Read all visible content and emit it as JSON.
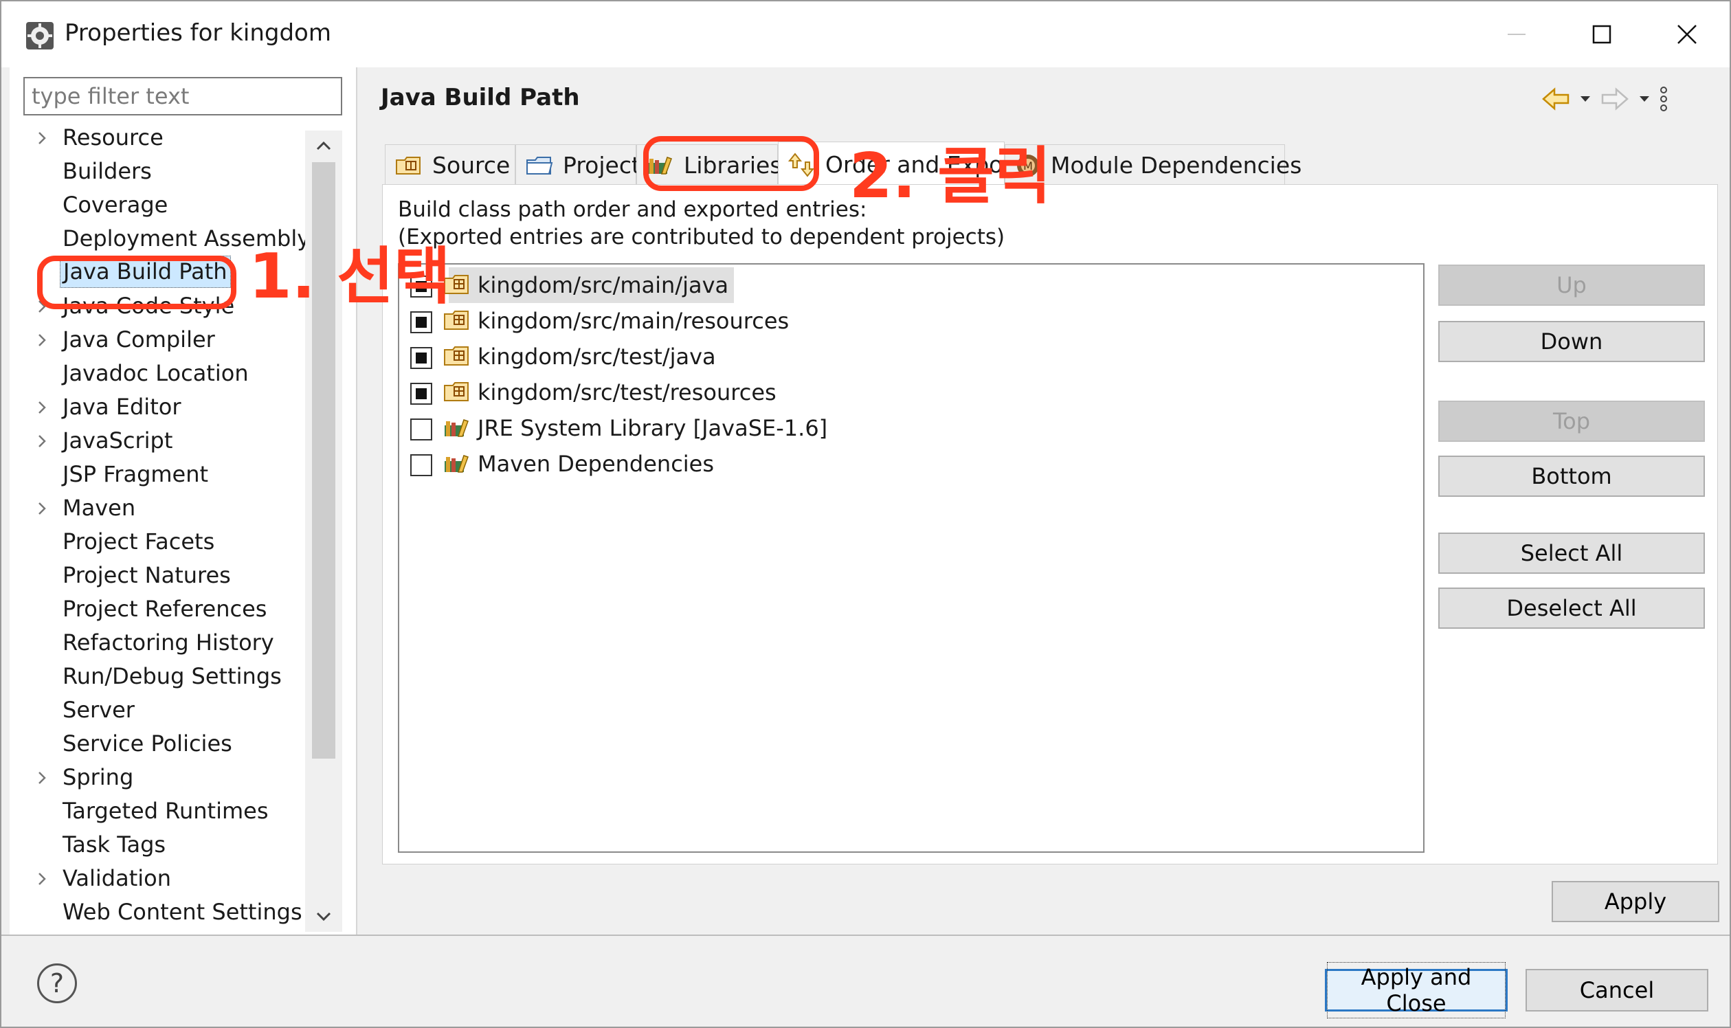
{
  "window": {
    "title": "Properties for kingdom",
    "icons": {
      "app": "gear-icon",
      "minimize": "minimize-icon",
      "maximize": "maximize-icon",
      "close": "close-icon"
    }
  },
  "filter": {
    "placeholder": "type filter text",
    "value": ""
  },
  "tree": {
    "items": [
      {
        "label": "Resource",
        "expandable": true
      },
      {
        "label": "Builders",
        "expandable": false
      },
      {
        "label": "Coverage",
        "expandable": false
      },
      {
        "label": "Deployment Assembly",
        "expandable": false
      },
      {
        "label": "Java Build Path",
        "expandable": false,
        "selected": true
      },
      {
        "label": "Java Code Style",
        "expandable": true
      },
      {
        "label": "Java Compiler",
        "expandable": true
      },
      {
        "label": "Javadoc Location",
        "expandable": false
      },
      {
        "label": "Java Editor",
        "expandable": true
      },
      {
        "label": "JavaScript",
        "expandable": true
      },
      {
        "label": "JSP Fragment",
        "expandable": false
      },
      {
        "label": "Maven",
        "expandable": true
      },
      {
        "label": "Project Facets",
        "expandable": false
      },
      {
        "label": "Project Natures",
        "expandable": false
      },
      {
        "label": "Project References",
        "expandable": false
      },
      {
        "label": "Refactoring History",
        "expandable": false
      },
      {
        "label": "Run/Debug Settings",
        "expandable": false
      },
      {
        "label": "Server",
        "expandable": false
      },
      {
        "label": "Service Policies",
        "expandable": false
      },
      {
        "label": "Spring",
        "expandable": true
      },
      {
        "label": "Targeted Runtimes",
        "expandable": false
      },
      {
        "label": "Task Tags",
        "expandable": false
      },
      {
        "label": "Validation",
        "expandable": true
      },
      {
        "label": "Web Content Settings",
        "expandable": false
      }
    ]
  },
  "page": {
    "title": "Java Build Path",
    "nav_icons": [
      "back-arrow-icon",
      "dropdown-icon",
      "forward-arrow-icon",
      "dropdown-icon",
      "view-menu-icon"
    ]
  },
  "tabs": [
    {
      "label": "Source",
      "icon": "source-folder-icon"
    },
    {
      "label": "Projects",
      "icon": "project-icon"
    },
    {
      "label": "Libraries",
      "icon": "library-icon"
    },
    {
      "label": "Order and Export",
      "icon": "order-export-icon",
      "active": true
    },
    {
      "label": "Module Dependencies",
      "icon": "module-icon"
    }
  ],
  "order_export": {
    "description_line1": "Build class path order and exported entries:",
    "description_line2": "(Exported entries are contributed to dependent projects)",
    "entries": [
      {
        "label": "kingdom/src/main/java",
        "checked": true,
        "icon": "source-folder-icon",
        "selected": true
      },
      {
        "label": "kingdom/src/main/resources",
        "checked": true,
        "icon": "source-folder-icon"
      },
      {
        "label": "kingdom/src/test/java",
        "checked": true,
        "icon": "source-folder-icon"
      },
      {
        "label": "kingdom/src/test/resources",
        "checked": true,
        "icon": "source-folder-icon"
      },
      {
        "label": "JRE System Library [JavaSE-1.6]",
        "checked": false,
        "icon": "library-icon"
      },
      {
        "label": "Maven Dependencies",
        "checked": false,
        "icon": "library-icon"
      }
    ],
    "buttons": [
      {
        "label": "Up",
        "enabled": false
      },
      {
        "label": "Down",
        "enabled": true
      },
      {
        "label": "Top",
        "enabled": false
      },
      {
        "label": "Bottom",
        "enabled": true
      },
      {
        "label": "Select All",
        "enabled": true
      },
      {
        "label": "Deselect All",
        "enabled": true
      }
    ]
  },
  "footer": {
    "apply": "Apply",
    "apply_and_close": "Apply and Close",
    "cancel": "Cancel",
    "help_icon": "help-icon"
  },
  "annotations": {
    "step1": "1. 선택",
    "step2": "2. 클릭",
    "color": "#ff3b1f"
  },
  "colors": {
    "selection": "#cce8ff",
    "default_button_border": "#2b78c5",
    "dialog_bg": "#f0f0f0"
  }
}
